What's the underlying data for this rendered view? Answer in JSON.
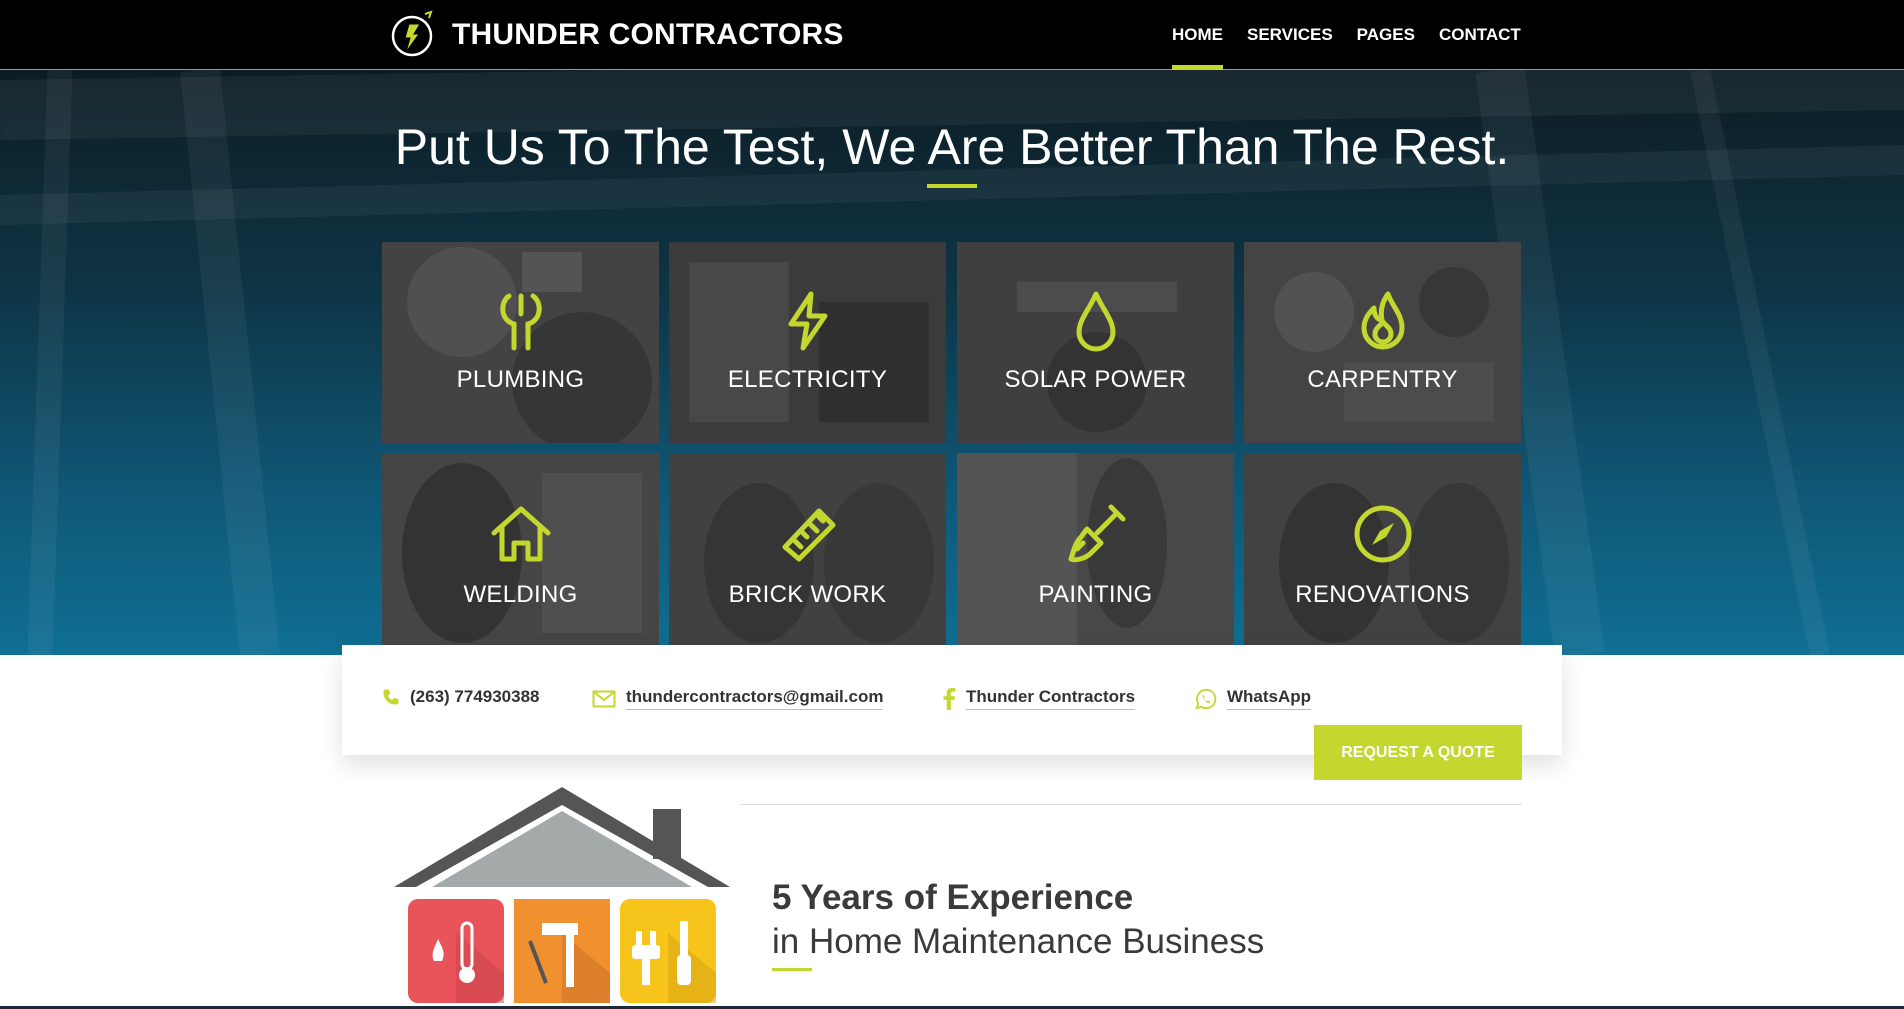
{
  "brand": {
    "name": "THUNDER CONTRACTORS",
    "logo_icon": "lightning-circle-logo"
  },
  "nav": {
    "items": [
      {
        "label": "HOME",
        "active": true
      },
      {
        "label": "SERVICES",
        "active": false
      },
      {
        "label": "PAGES",
        "active": false
      },
      {
        "label": "CONTACT",
        "active": false
      }
    ]
  },
  "hero": {
    "title": "Put Us To The Test, We Are Better Than The Rest."
  },
  "services": [
    {
      "label": "PLUMBING",
      "icon": "wrench-icon"
    },
    {
      "label": "ELECTRICITY",
      "icon": "lightning-icon"
    },
    {
      "label": "SOLAR POWER",
      "icon": "drop-icon"
    },
    {
      "label": "CARPENTRY",
      "icon": "flame-icon"
    },
    {
      "label": "WELDING",
      "icon": "house-icon"
    },
    {
      "label": "BRICK WORK",
      "icon": "ruler-icon"
    },
    {
      "label": "PAINTING",
      "icon": "paint-brush-icon"
    },
    {
      "label": "RENOVATIONS",
      "icon": "compass-icon"
    }
  ],
  "contact": {
    "phone": "(263) 774930388",
    "email": "thundercontractors@gmail.com",
    "facebook": "Thunder Contractors",
    "whatsapp": "WhatsApp",
    "quote_button": "REQUEST A QUOTE"
  },
  "experience": {
    "title": "5 Years of Experience",
    "subtitle": "in Home Maintenance Business"
  },
  "colors": {
    "accent": "#c4d72f",
    "nav_bg": "#000000",
    "hero_blue": "#0f6f94"
  }
}
